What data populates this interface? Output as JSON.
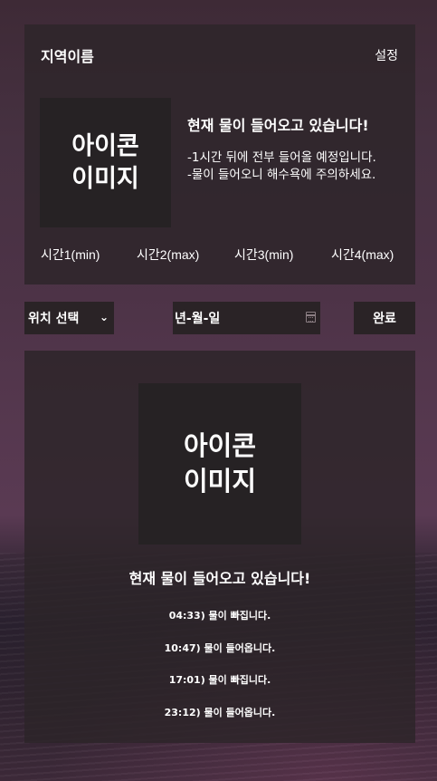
{
  "header": {
    "region_name": "지역이름",
    "settings_label": "설정"
  },
  "top_card": {
    "icon_placeholder": "아이콘\n이미지",
    "status_title": "현재 물이 들어오고 있습니다!",
    "status_lines": [
      "-1시간 뒤에 전부 들어올 예정입니다.",
      "-물이 들어오니 해수욕에 주의하세요."
    ],
    "time_labels": [
      "시간1(min)",
      "시간2(max)",
      "시간3(min)",
      "시간4(max)"
    ]
  },
  "controls": {
    "location_select": "위치 선택",
    "date_placeholder": "년-월-일",
    "done_label": "완료"
  },
  "bottom_card": {
    "icon_placeholder": "아이콘\n이미지",
    "status_title": "현재 물이 들어오고 있습니다!",
    "schedule": [
      "04:33) 물이 빠집니다.",
      "10:47) 물이 들어옵니다.",
      "17:01) 물이 빠집니다.",
      "23:12) 물이 들어옵니다."
    ]
  },
  "colors": {
    "card_background": "#2e262a",
    "control_background": "#2a2326",
    "text": "#ffffff"
  }
}
